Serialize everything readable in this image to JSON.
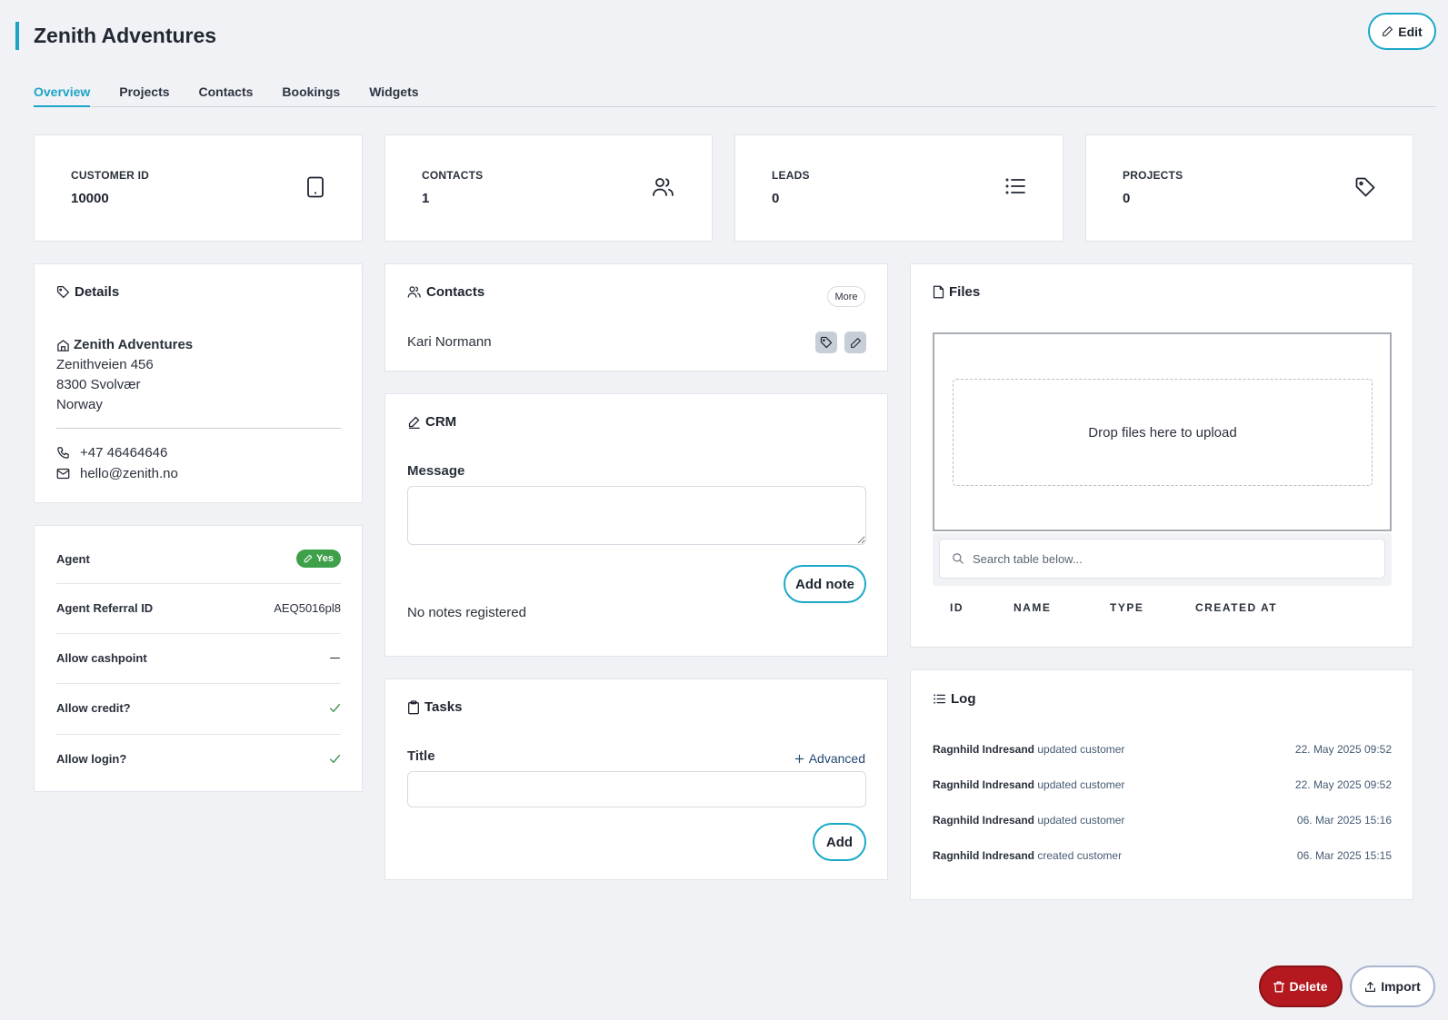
{
  "header": {
    "title": "Zenith Adventures",
    "edit_label": "Edit"
  },
  "tabs": [
    {
      "label": "Overview",
      "active": true
    },
    {
      "label": "Projects"
    },
    {
      "label": "Contacts"
    },
    {
      "label": "Bookings"
    },
    {
      "label": "Widgets"
    }
  ],
  "stats": [
    {
      "label": "CUSTOMER ID",
      "value": "10000",
      "icon": "tablet-icon"
    },
    {
      "label": "CONTACTS",
      "value": "1",
      "icon": "users-icon"
    },
    {
      "label": "LEADS",
      "value": "0",
      "icon": "list-icon"
    },
    {
      "label": "PROJECTS",
      "value": "0",
      "icon": "tag-icon"
    }
  ],
  "details": {
    "title": "Details",
    "name": "Zenith Adventures",
    "street": "Zenithveien 456",
    "city": "8300 Svolvær",
    "country": "Norway",
    "phone": "+47 46464646",
    "email": "hello@zenith.no"
  },
  "flags": {
    "agent_label": "Agent",
    "agent_value": "Yes",
    "referral_label": "Agent Referral ID",
    "referral_value": "AEQ5016pl8",
    "cashpoint_label": "Allow cashpoint",
    "credit_label": "Allow credit?",
    "login_label": "Allow login?"
  },
  "contacts_card": {
    "title": "Contacts",
    "more_label": "More",
    "items": [
      {
        "name": "Kari Normann"
      }
    ]
  },
  "crm": {
    "title": "CRM",
    "message_label": "Message",
    "add_note_label": "Add note",
    "empty_text": "No notes registered"
  },
  "tasks": {
    "title": "Tasks",
    "title_label": "Title",
    "advanced_label": "Advanced",
    "add_label": "Add"
  },
  "files": {
    "title": "Files",
    "dropzone_text": "Drop files here to upload",
    "search_placeholder": "Search table below...",
    "columns": [
      "ID",
      "NAME",
      "TYPE",
      "CREATED AT"
    ]
  },
  "log": {
    "title": "Log",
    "entries": [
      {
        "user": "Ragnhild Indresand",
        "action": "updated customer",
        "time": "22. May 2025 09:52"
      },
      {
        "user": "Ragnhild Indresand",
        "action": "updated customer",
        "time": "22. May 2025 09:52"
      },
      {
        "user": "Ragnhild Indresand",
        "action": "updated customer",
        "time": "06. Mar 2025 15:16"
      },
      {
        "user": "Ragnhild Indresand",
        "action": "created customer",
        "time": "06. Mar 2025 15:15"
      }
    ]
  },
  "footer": {
    "delete_label": "Delete",
    "import_label": "Import"
  },
  "colors": {
    "accent": "#1ca3c6",
    "danger": "#b3191f",
    "success": "#3fa04a"
  }
}
